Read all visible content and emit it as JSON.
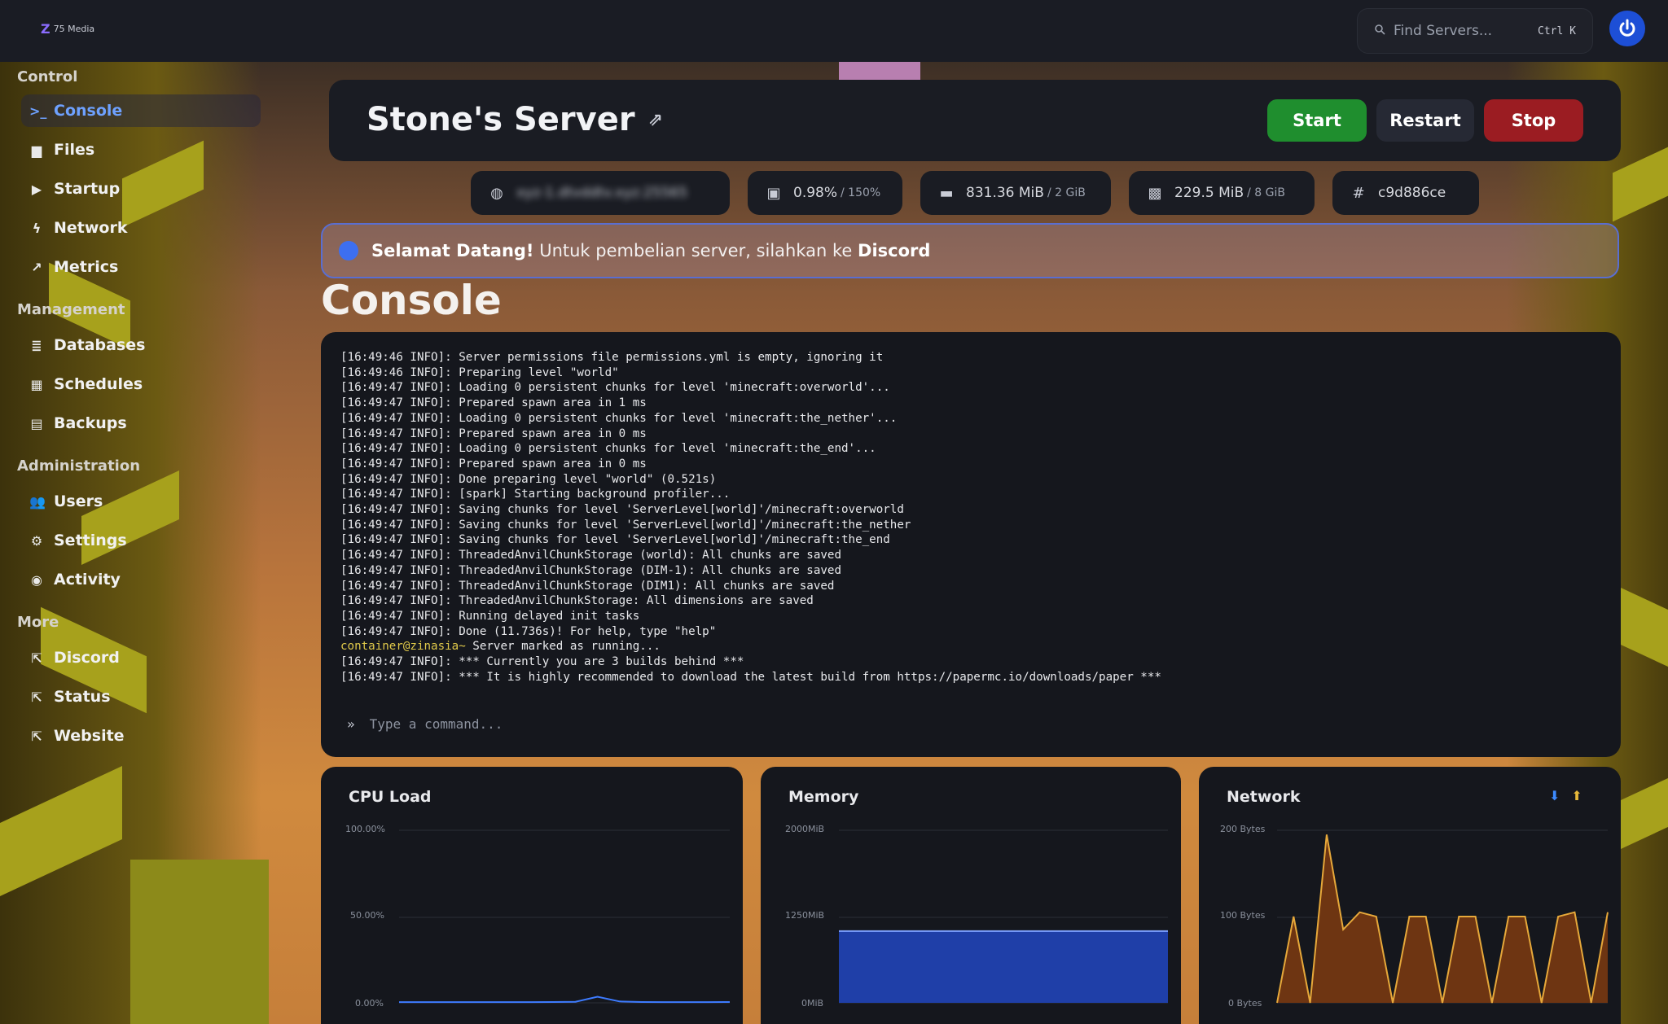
{
  "topbar": {
    "logo_mark": "Z",
    "logo_text": "75 Media",
    "search_placeholder": "Find Servers...",
    "search_shortcut": "Ctrl K"
  },
  "sidebar": {
    "sections": [
      {
        "title": "Control",
        "items": [
          {
            "label": "Console",
            "icon": "terminal-icon",
            "active": true
          },
          {
            "label": "Files",
            "icon": "folder-icon"
          },
          {
            "label": "Startup",
            "icon": "play-icon"
          },
          {
            "label": "Network",
            "icon": "network-icon"
          },
          {
            "label": "Metrics",
            "icon": "chart-icon"
          }
        ]
      },
      {
        "title": "Management",
        "items": [
          {
            "label": "Databases",
            "icon": "database-icon"
          },
          {
            "label": "Schedules",
            "icon": "calendar-icon"
          },
          {
            "label": "Backups",
            "icon": "archive-icon"
          }
        ]
      },
      {
        "title": "Administration",
        "items": [
          {
            "label": "Users",
            "icon": "users-icon"
          },
          {
            "label": "Settings",
            "icon": "gear-icon"
          },
          {
            "label": "Activity",
            "icon": "eye-icon"
          }
        ]
      },
      {
        "title": "More",
        "items": [
          {
            "label": "Discord",
            "icon": "external-link-icon"
          },
          {
            "label": "Status",
            "icon": "external-link-icon"
          },
          {
            "label": "Website",
            "icon": "external-link-icon"
          }
        ]
      }
    ]
  },
  "header": {
    "server_name": "Stone's Server",
    "start_label": "Start",
    "restart_label": "Restart",
    "stop_label": "Stop"
  },
  "stats": {
    "address": "xyz-1.dtvddtv.xyz:25565",
    "cpu_value": "0.98%",
    "cpu_limit": "/ 150%",
    "memory_value": "831.36 MiB",
    "memory_limit": "/ 2 GiB",
    "disk_value": "229.5 MiB",
    "disk_limit": "/ 8 GiB",
    "server_id": "c9d886ce"
  },
  "alert": {
    "bold": "Selamat Datang!",
    "message": "Untuk pembelian server, silahkan ke",
    "link": "Discord",
    "dot_color": "#3d6ff0"
  },
  "console": {
    "heading": "Console",
    "command_placeholder": "Type a command...",
    "lines": [
      "[16:49:46 INFO]: Server permissions file permissions.yml is empty, ignoring it",
      "[16:49:46 INFO]: Preparing level \"world\"",
      "[16:49:47 INFO]: Loading 0 persistent chunks for level 'minecraft:overworld'...",
      "[16:49:47 INFO]: Prepared spawn area in 1 ms",
      "[16:49:47 INFO]: Loading 0 persistent chunks for level 'minecraft:the_nether'...",
      "[16:49:47 INFO]: Prepared spawn area in 0 ms",
      "[16:49:47 INFO]: Loading 0 persistent chunks for level 'minecraft:the_end'...",
      "[16:49:47 INFO]: Prepared spawn area in 0 ms",
      "[16:49:47 INFO]: Done preparing level \"world\" (0.521s)",
      "[16:49:47 INFO]: [spark] Starting background profiler...",
      "[16:49:47 INFO]: Saving chunks for level 'ServerLevel[world]'/minecraft:overworld",
      "[16:49:47 INFO]: Saving chunks for level 'ServerLevel[world]'/minecraft:the_nether",
      "[16:49:47 INFO]: Saving chunks for level 'ServerLevel[world]'/minecraft:the_end",
      "[16:49:47 INFO]: ThreadedAnvilChunkStorage (world): All chunks are saved",
      "[16:49:47 INFO]: ThreadedAnvilChunkStorage (DIM-1): All chunks are saved",
      "[16:49:47 INFO]: ThreadedAnvilChunkStorage (DIM1): All chunks are saved",
      "[16:49:47 INFO]: ThreadedAnvilChunkStorage: All dimensions are saved",
      "[16:49:47 INFO]: Running delayed init tasks",
      "[16:49:47 INFO]: Done (11.736s)! For help, type \"help\"",
      "@@container@zinasia~ Server marked as running...",
      "[16:49:47 INFO]: *** Currently you are 3 builds behind ***",
      "[16:49:47 INFO]: *** It is highly recommended to download the latest build from https://papermc.io/downloads/paper ***"
    ]
  },
  "graphs": {
    "cpu": {
      "title": "CPU Load",
      "ticks": [
        "100.00%",
        "50.00%",
        "0.00%"
      ],
      "color": "#3d7bff"
    },
    "memory": {
      "title": "Memory",
      "ticks": [
        "2000MiB",
        "1250MiB",
        "0MiB"
      ],
      "color": "#1f3fa8",
      "fill_fraction": 0.42
    },
    "network": {
      "title": "Network",
      "ticks": [
        "200 Bytes",
        "100 Bytes",
        "0 Bytes"
      ],
      "color": "#e6a83a",
      "legend_in_color": "#3d8bff",
      "legend_out_color": "#e6b83a"
    }
  },
  "chart_data": [
    {
      "type": "line",
      "title": "CPU Load",
      "ylim": [
        0,
        100
      ],
      "y_unit": "%",
      "series": [
        {
          "values": [
            0.4,
            0.4,
            0.4,
            0.4,
            0.4,
            0.4,
            0.4,
            0.5,
            0.6,
            3.5,
            0.8,
            0.5,
            0.4,
            0.4,
            0.4,
            0.5
          ]
        }
      ]
    },
    {
      "type": "area",
      "title": "Memory",
      "ylim": [
        0,
        2000
      ],
      "y_unit": "MiB",
      "series": [
        {
          "values": [
            831,
            831,
            831,
            831,
            831,
            831,
            831,
            831
          ]
        }
      ]
    },
    {
      "type": "area",
      "title": "Network",
      "ylim": [
        0,
        200
      ],
      "y_unit": "Bytes",
      "series": [
        {
          "values": [
            0,
            100,
            0,
            195,
            85,
            105,
            100,
            0,
            100,
            100,
            0,
            100,
            100,
            0,
            100,
            100,
            0,
            100,
            105,
            0,
            105
          ]
        }
      ]
    }
  ]
}
